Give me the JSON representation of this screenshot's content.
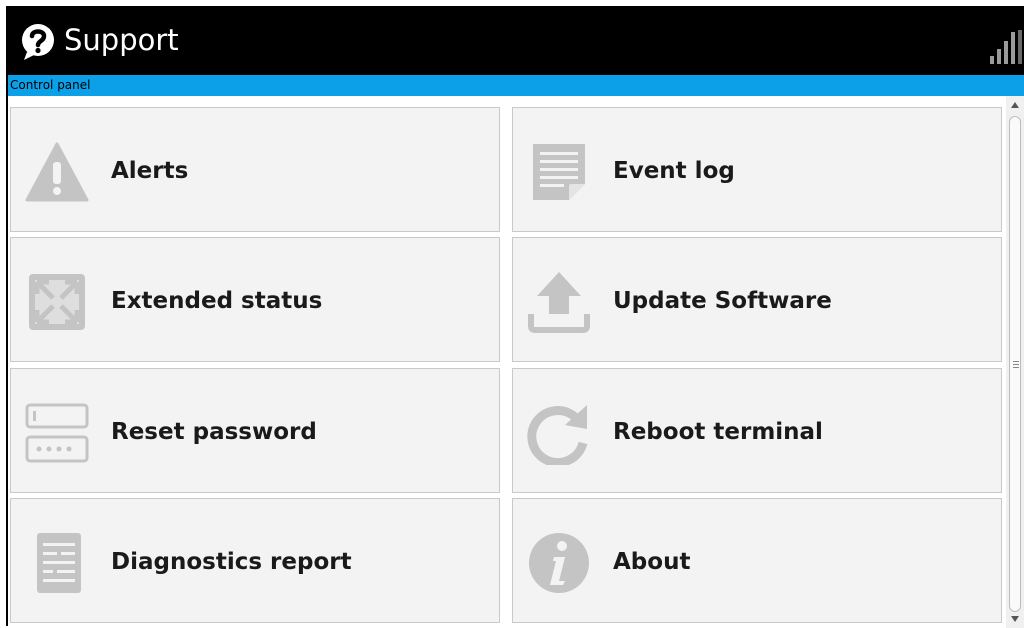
{
  "header": {
    "title": "Support",
    "app_icon": "support-question-icon",
    "signal_icon": "signal-strength-icon"
  },
  "breadcrumb": {
    "text": "Control panel"
  },
  "colors": {
    "header_bg": "#000000",
    "breadcrumb_bg": "#0ba0e8",
    "tile_bg": "#f3f3f3",
    "icon_gray": "#c4c4c4"
  },
  "tiles": [
    {
      "label": "Alerts",
      "icon": "warning-triangle-icon"
    },
    {
      "label": "Event log",
      "icon": "document-log-icon"
    },
    {
      "label": "Extended status",
      "icon": "expand-arrows-icon"
    },
    {
      "label": "Update Software",
      "icon": "upload-arrow-icon"
    },
    {
      "label": "Reset password",
      "icon": "password-field-icon"
    },
    {
      "label": "Reboot terminal",
      "icon": "reboot-arrow-icon"
    },
    {
      "label": "Diagnostics report",
      "icon": "report-sheet-icon"
    },
    {
      "label": "About",
      "icon": "info-icon"
    }
  ]
}
